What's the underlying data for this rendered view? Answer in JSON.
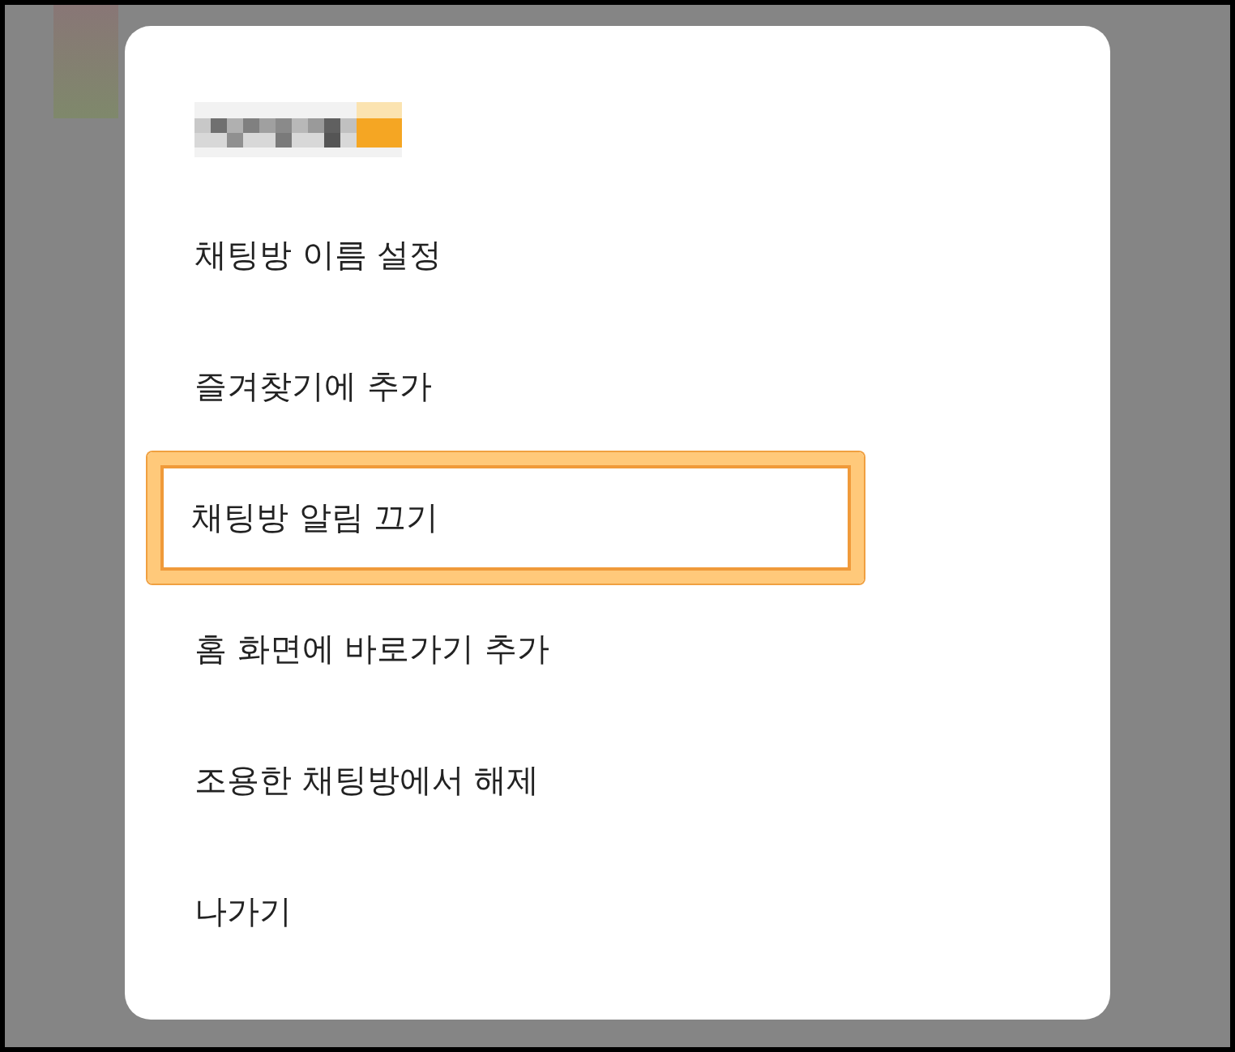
{
  "menu": {
    "items": [
      {
        "label": "채팅방 이름 설정",
        "highlighted": false
      },
      {
        "label": "즐겨찾기에 추가",
        "highlighted": false
      },
      {
        "label": "채팅방 알림 끄기",
        "highlighted": true
      },
      {
        "label": "홈 화면에 바로가기 추가",
        "highlighted": false
      },
      {
        "label": "조용한 채팅방에서 해제",
        "highlighted": false
      },
      {
        "label": "나가기",
        "highlighted": false
      }
    ]
  }
}
